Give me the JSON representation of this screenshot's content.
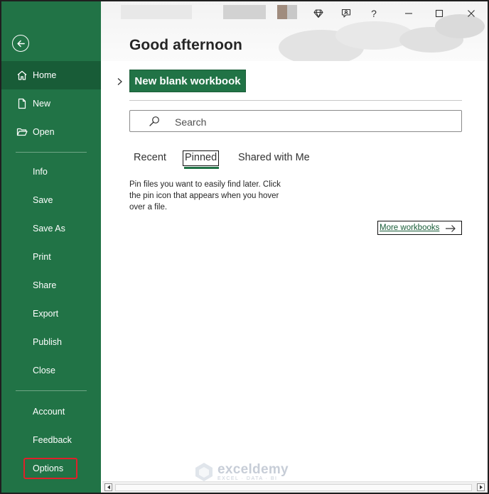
{
  "header": {
    "greeting": "Good afternoon",
    "buttons": {
      "premium_icon": "diamond-icon",
      "coauthor_icon": "people-icon",
      "help_label": "?",
      "minimize_icon": "minimize-icon",
      "close_icon": "close-icon"
    }
  },
  "sidebar": {
    "back_icon": "back-arrow-icon",
    "items": [
      {
        "label": "Home",
        "icon": "home-icon",
        "active": true
      },
      {
        "label": "New",
        "icon": "new-document-icon"
      },
      {
        "label": "Open",
        "icon": "open-folder-icon"
      },
      {
        "label": "Info"
      },
      {
        "label": "Save"
      },
      {
        "label": "Save As"
      },
      {
        "label": "Print"
      },
      {
        "label": "Share"
      },
      {
        "label": "Export"
      },
      {
        "label": "Publish"
      },
      {
        "label": "Close"
      },
      {
        "label": "Account"
      },
      {
        "label": "Feedback"
      },
      {
        "label": "Options",
        "highlighted": true
      }
    ]
  },
  "main": {
    "new_blank_label": "New blank workbook",
    "search": {
      "placeholder": "Search"
    },
    "tabs": [
      {
        "label": "Recent"
      },
      {
        "label": "Pinned",
        "selected": true
      },
      {
        "label": "Shared with Me"
      }
    ],
    "pinned_message": "Pin files you want to easily find later. Click the pin icon that appears when you hover over a file.",
    "more_workbooks_label": "More workbooks"
  },
  "watermark": {
    "name": "exceldemy",
    "tagline": "EXCEL · DATA · BI"
  },
  "colors": {
    "accent": "#217346",
    "accent_dark": "#185c37",
    "highlight": "#e0202a"
  }
}
